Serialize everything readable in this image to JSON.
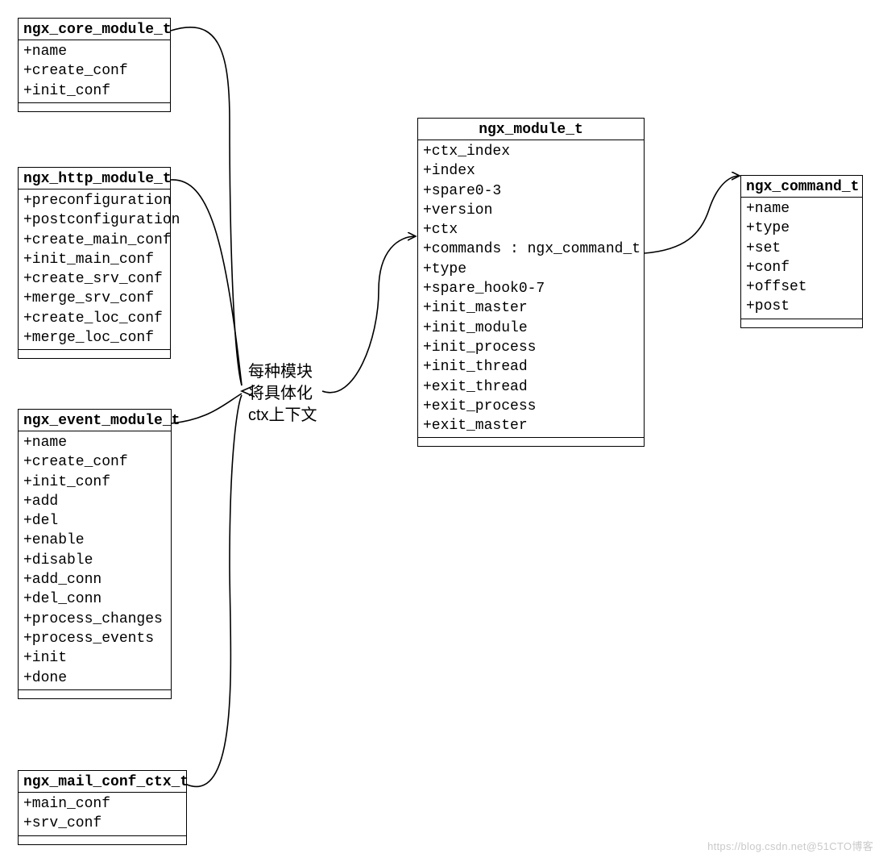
{
  "classes": {
    "core": {
      "title": "ngx_core_module_t",
      "attrs": [
        "+name",
        "+create_conf",
        "+init_conf"
      ]
    },
    "http": {
      "title": "ngx_http_module_t",
      "attrs": [
        "+preconfiguration",
        "+postconfiguration",
        "+create_main_conf",
        "+init_main_conf",
        "+create_srv_conf",
        "+merge_srv_conf",
        "+create_loc_conf",
        "+merge_loc_conf"
      ]
    },
    "event": {
      "title": "ngx_event_module_t",
      "attrs": [
        "+name",
        "+create_conf",
        "+init_conf",
        "+add",
        "+del",
        "+enable",
        "+disable",
        "+add_conn",
        "+del_conn",
        "+process_changes",
        "+process_events",
        "+init",
        "+done"
      ]
    },
    "mail": {
      "title": "ngx_mail_conf_ctx_t",
      "attrs": [
        "+main_conf",
        "+srv_conf"
      ]
    },
    "module": {
      "title": "ngx_module_t",
      "attrs": [
        "+ctx_index",
        "+index",
        "+spare0-3",
        "+version",
        "+ctx",
        "+commands : ngx_command_t",
        "+type",
        "+spare_hook0-7",
        "+init_master",
        "+init_module",
        "+init_process",
        "+init_thread",
        "+exit_thread",
        "+exit_process",
        "+exit_master"
      ]
    },
    "command": {
      "title": "ngx_command_t",
      "attrs": [
        "+name",
        "+type",
        "+set",
        "+conf",
        "+offset",
        "+post"
      ]
    }
  },
  "label": {
    "l1": "每种模块",
    "l2": "将具体化",
    "l3": "ctx上下文"
  },
  "watermark": "https://blog.csdn.net@51CTO博客"
}
